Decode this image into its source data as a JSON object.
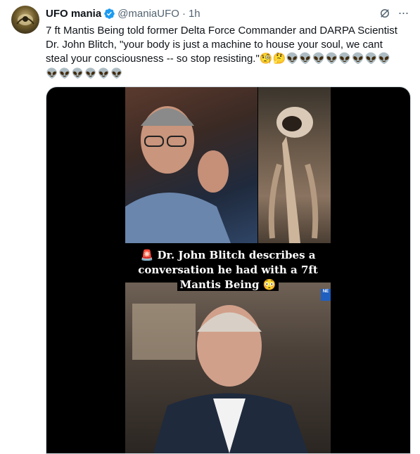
{
  "author": {
    "name": "UFO mania",
    "handle": "@maniaUFO",
    "separator": "·",
    "time": "1h",
    "verified_icon": "verified-badge-icon"
  },
  "actions": {
    "grok_icon": "grok-icon",
    "more_label": "···"
  },
  "tweet": {
    "line1": "7 ft Mantis Being told former Delta Force  Commander and DARPA Scientist",
    "line2": "Dr. John Blitch, \"your body is just a machine to house your soul, we cant",
    "line3": "steal your consciousness -- so stop resisting.\"🧐🤔👽👽👽👽👽👽👽👽",
    "line4": "👽👽👽👽👽👽"
  },
  "video": {
    "caption_line1": "🚨 Dr. John Blitch describes a",
    "caption_line2": "conversation he had with a 7ft",
    "caption_line3": "Mantis Being 😳",
    "badge": "NE"
  },
  "colors": {
    "text": "#0f1419",
    "secondary": "#536471",
    "verified": "#1d9bf0",
    "media_bg": "#000000"
  }
}
